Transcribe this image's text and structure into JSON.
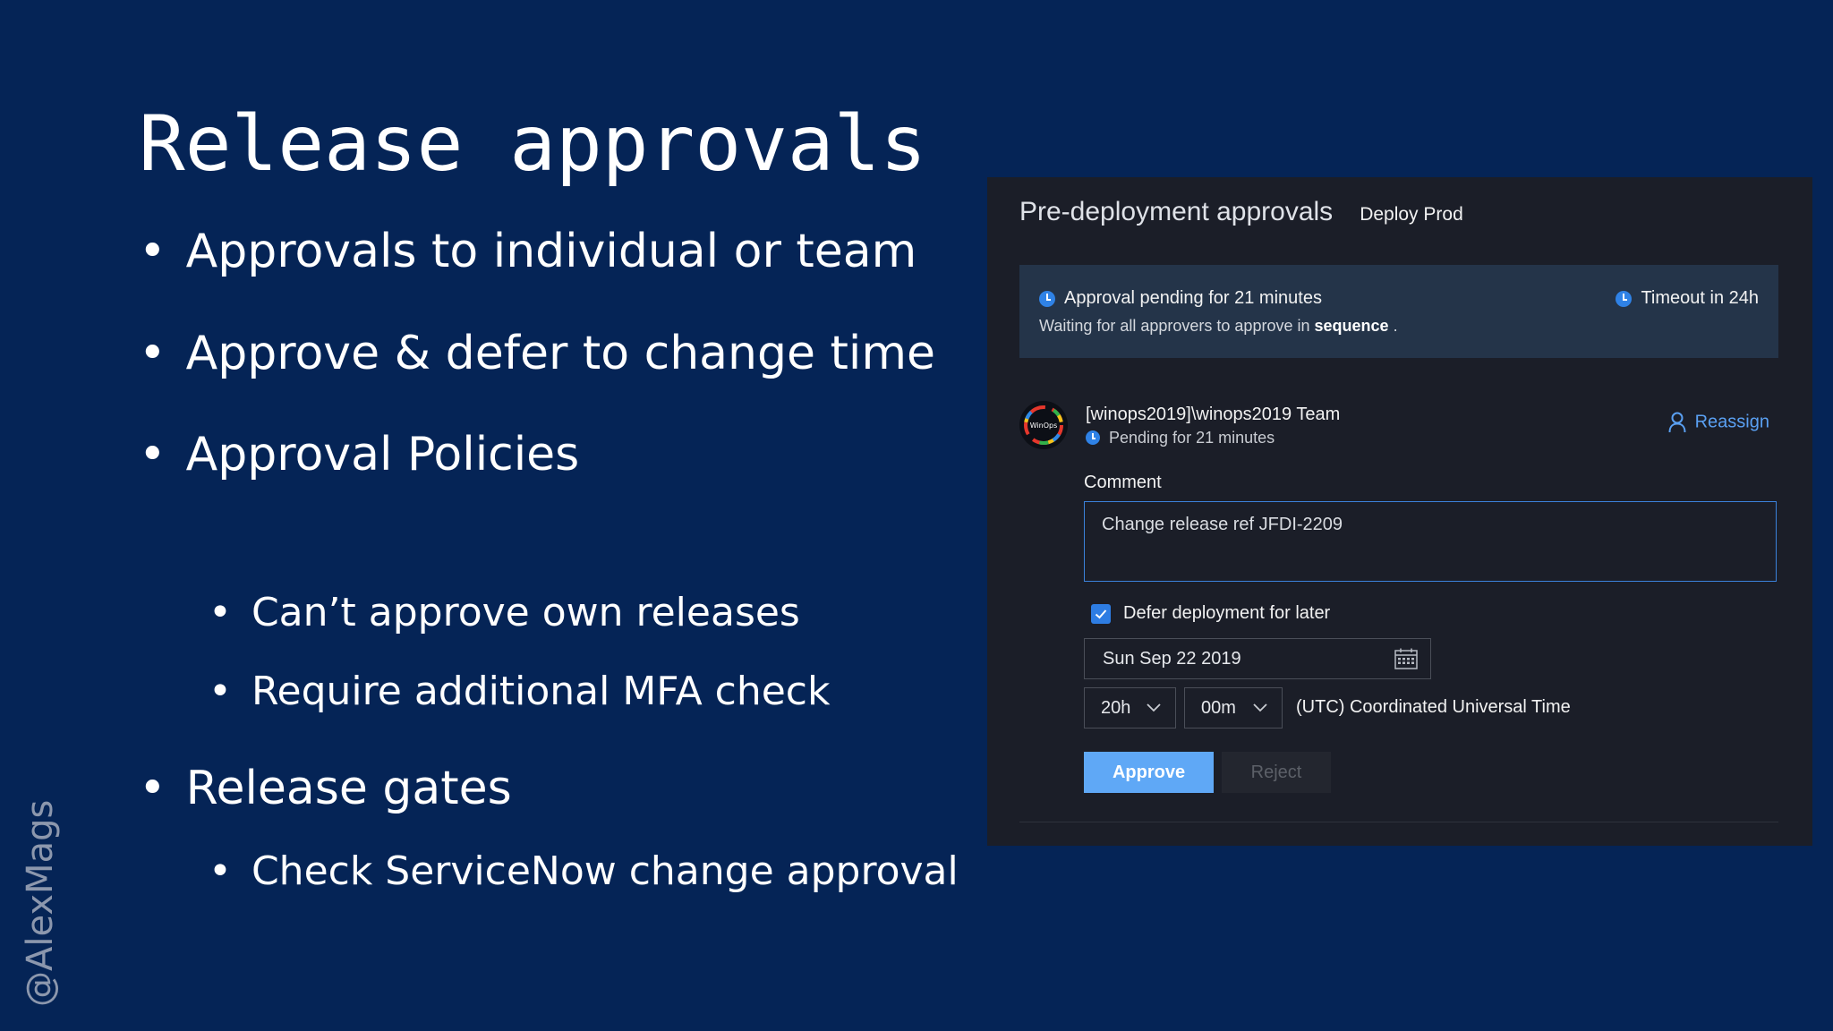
{
  "slide": {
    "title": "Release approvals",
    "bullets": [
      "Approvals to individual or team",
      "Approve & defer to change time",
      "Approval Policies",
      "Can’t approve own releases",
      "Require additional MFA check",
      "Release gates",
      "Check ServiceNow change approval"
    ],
    "bullet_glyph": "•",
    "watermark": "@AlexMags"
  },
  "panel": {
    "title": "Pre-deployment approvals",
    "stage": "Deploy Prod",
    "status": {
      "pending": "Approval pending for 21 minutes",
      "waiting_prefix": "Waiting for all approvers to approve in",
      "waiting_mode": "sequence",
      "waiting_suffix": ".",
      "timeout": "Timeout in 24h",
      "icon": "clock-icon"
    },
    "approver": {
      "name": "[winops2019]\\winops2019 Team",
      "status": "Pending for 21 minutes",
      "reassign_label": "Reassign",
      "avatar_text": "WinOps"
    },
    "comment": {
      "label": "Comment",
      "value": "Change release ref JFDI-2209"
    },
    "defer": {
      "label": "Defer deployment for later",
      "checked": true,
      "date": "Sun Sep 22 2019",
      "hours": "20h",
      "minutes": "00m",
      "timezone": "(UTC) Coordinated Universal Time"
    },
    "buttons": {
      "approve": "Approve",
      "reject": "Reject"
    }
  },
  "colors": {
    "slide_background": "#052456",
    "panel_background": "#1b1e28",
    "status_background": "#243449",
    "accent": "#5aa0f2",
    "approve_button": "#5fa8f6"
  }
}
